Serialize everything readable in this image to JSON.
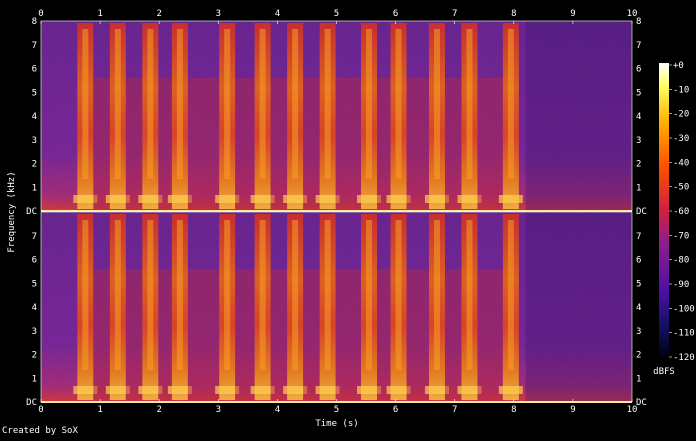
{
  "chart_data": {
    "type": "heatmap",
    "x_label": "Time (s)",
    "y_label": "Frequency (kHz)",
    "x_ticks": [
      "0",
      "1",
      "2",
      "3",
      "4",
      "5",
      "6",
      "7",
      "8",
      "9",
      "10"
    ],
    "y_ticks": [
      "DC",
      "1",
      "2",
      "3",
      "4",
      "5",
      "6",
      "7",
      "8"
    ],
    "x_range": [
      0,
      10
    ],
    "y_range_khz": [
      0,
      8
    ],
    "channels": 2,
    "colorbar": {
      "label": "dBFS",
      "ticks": [
        "+0",
        "-10",
        "-20",
        "-30",
        "-40",
        "-50",
        "-60",
        "-70",
        "-80",
        "-90",
        "-100",
        "-110",
        "-120"
      ],
      "range": [
        -120,
        0
      ]
    },
    "speech_bursts_s": [
      0.75,
      1.3,
      1.85,
      2.35,
      3.15,
      3.75,
      4.3,
      4.85,
      5.55,
      6.05,
      6.7,
      7.25,
      7.95
    ],
    "silence_after_s": 8.2
  },
  "footer": {
    "credit": "Created by SoX"
  }
}
